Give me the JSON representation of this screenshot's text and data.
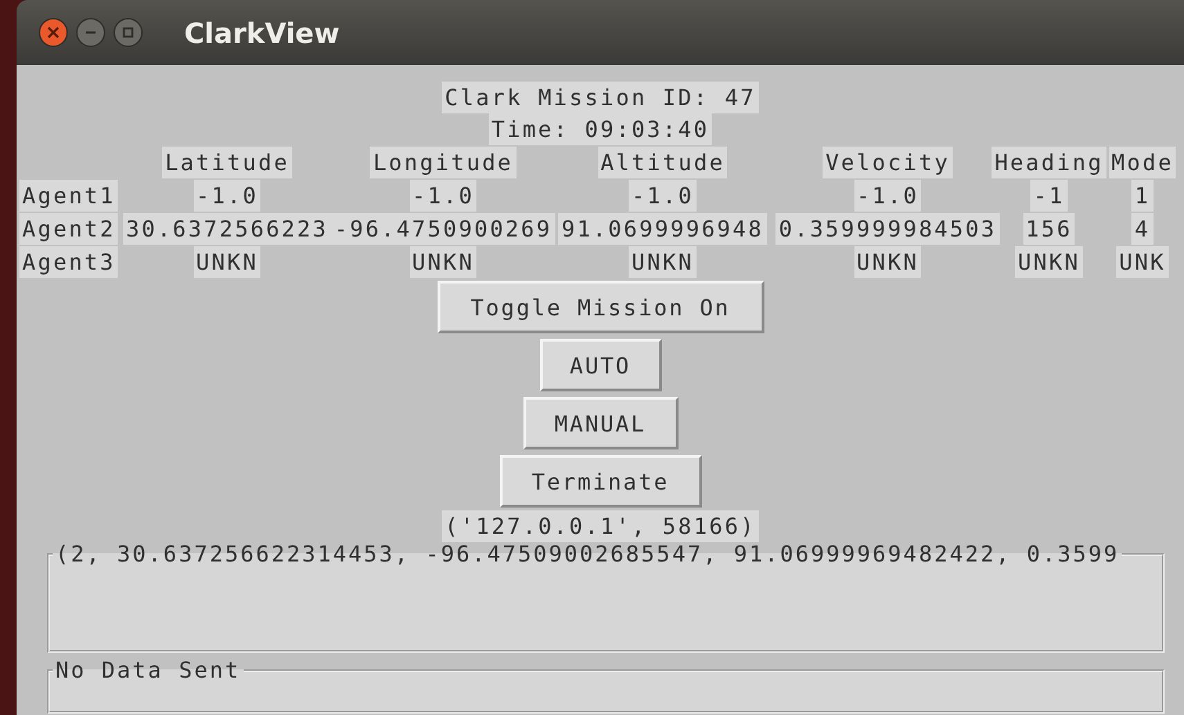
{
  "window": {
    "title": "ClarkView"
  },
  "mission_id": "Clark Mission ID: 47",
  "time": "Time: 09:03:40",
  "table": {
    "columns": [
      "Latitude",
      "Longitude",
      "Altitude",
      "Velocity",
      "Heading",
      "Mode"
    ],
    "rows": [
      {
        "agent": "Agent1",
        "cells": [
          "-1.0",
          "-1.0",
          "-1.0",
          "-1.0",
          "-1",
          "1"
        ]
      },
      {
        "agent": "Agent2",
        "cells": [
          "30.6372566223",
          "-96.4750900269",
          "91.0699996948",
          "0.359999984503",
          "156",
          "4"
        ]
      },
      {
        "agent": "Agent3",
        "cells": [
          "UNKN",
          "UNKN",
          "UNKN",
          "UNKN",
          "UNKN",
          "UNK"
        ]
      }
    ]
  },
  "buttons": [
    "Toggle Mission On",
    "AUTO",
    "MANUAL",
    "Terminate"
  ],
  "address": "('127.0.0.1', 58166)",
  "received": {
    "label": "(2, 30.637256622314453, -96.47509002685547, 91.06999969482422, 0.3599"
  },
  "sent": {
    "label": "No Data Sent"
  }
}
